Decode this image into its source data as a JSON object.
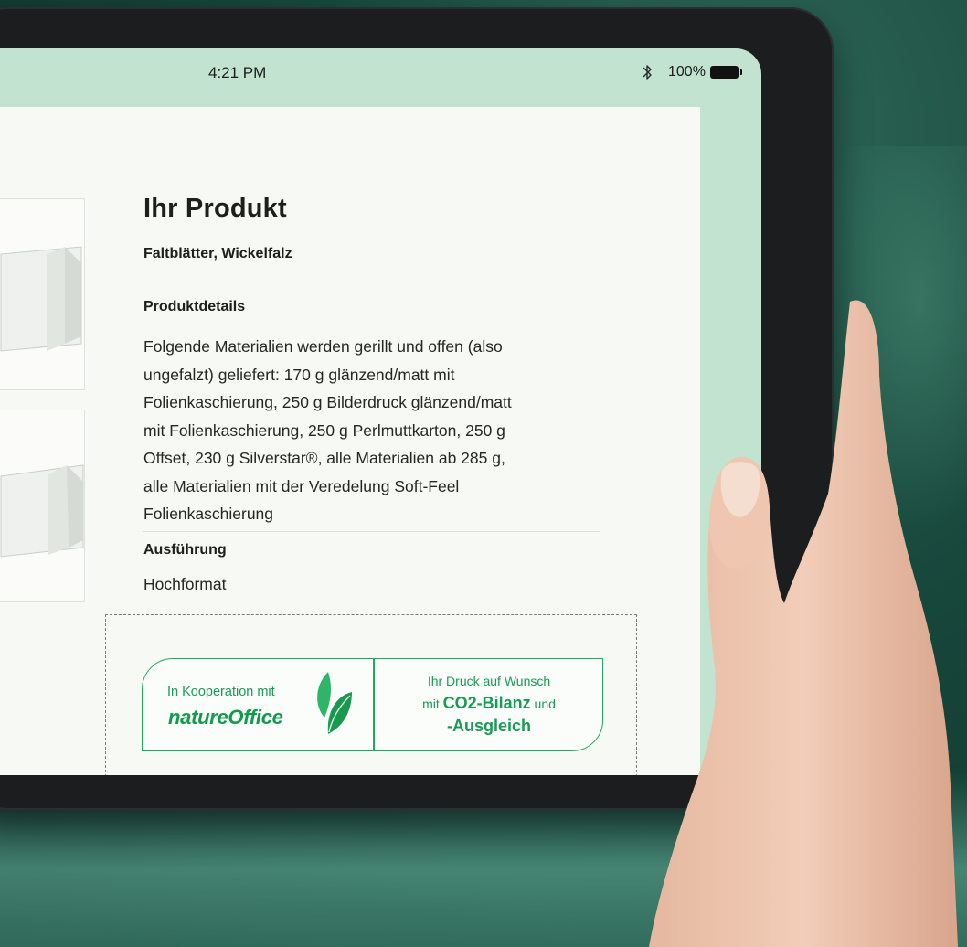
{
  "status_bar": {
    "time": "4:21 PM",
    "battery_percent": "100%",
    "bluetooth_icon": "bluetooth-icon",
    "battery_icon": "battery-full-icon"
  },
  "product": {
    "title": "Ihr Produkt",
    "subtitle": "Faltblätter, Wickelfalz",
    "details_heading": "Produktdetails",
    "details_text": "Folgende Materialien werden gerillt und offen (also ungefalzt) geliefert: 170 g glänzend/matt mit Folienkaschierung, 250 g Bilderdruck glänzend/matt mit Folienkaschierung, 250 g Perlmuttkarton, 250 g Offset, 230 g Silverstar®, alle Materialien ab 285 g, alle Materialien mit der Veredelung Soft-Feel Folienkaschierung",
    "execution_heading": "Ausführung",
    "execution_value": "Hochformat"
  },
  "eco_badge": {
    "cooperation_label": "In Kooperation mit",
    "brand_logo_text": "natureOffice",
    "leaf_icon": "leaf-icon",
    "line1": "Ihr Druck auf Wunsch",
    "line2_prefix": "mit",
    "line2_highlight": "CO2-Bilanz",
    "line2_suffix": "und",
    "line3": "-Ausgleich"
  },
  "colors": {
    "accent_green": "#1a9a55",
    "screen_mint": "#c1e3cf",
    "page_background": "#f6f9f4"
  }
}
